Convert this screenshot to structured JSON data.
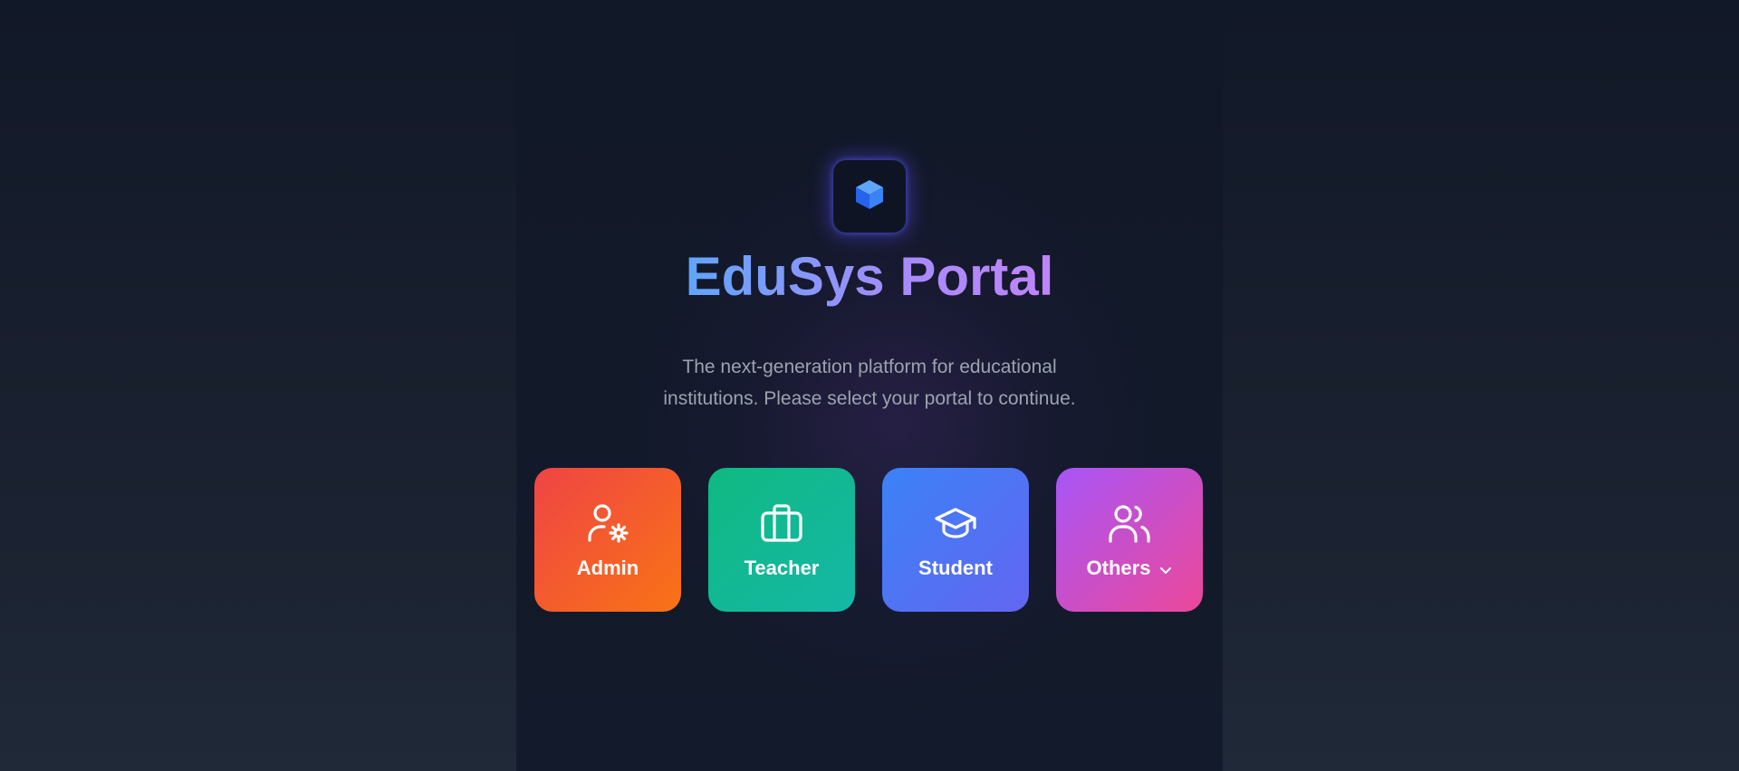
{
  "app": {
    "title": "EduSys Portal",
    "subtitle_line1": "The next-generation platform for educational",
    "subtitle_line2": "institutions. Please select your portal to continue.",
    "logo_icon": "cube-icon"
  },
  "portals": [
    {
      "label": "Admin",
      "icon": "user-cog-icon",
      "color_from": "#ef4444",
      "color_to": "#f97316"
    },
    {
      "label": "Teacher",
      "icon": "briefcase-icon",
      "color_from": "#10b981",
      "color_to": "#14b8a6"
    },
    {
      "label": "Student",
      "icon": "graduation-cap-icon",
      "color_from": "#3b82f6",
      "color_to": "#6366f1"
    },
    {
      "label": "Others",
      "icon": "users-icon",
      "color_from": "#a855f7",
      "color_to": "#ec4899",
      "has_dropdown": true
    }
  ],
  "colors": {
    "background": "#111827",
    "title_gradient_from": "#60a5fa",
    "title_gradient_to": "#c084fc",
    "subtitle": "#9ca3af"
  }
}
